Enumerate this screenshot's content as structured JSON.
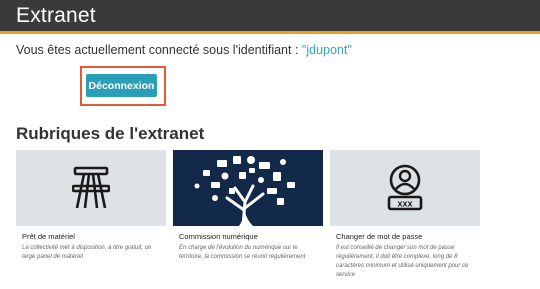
{
  "header": {
    "title": "Extranet"
  },
  "welcome": {
    "prefix": "Vous êtes actuellement connecté sous l'identifiant : ",
    "username": "\"jdupont\""
  },
  "logout": {
    "label": "Déconnexion"
  },
  "section": {
    "title": "Rubriques de l'extranet"
  },
  "cards": [
    {
      "title": "Prêt de matériel",
      "text": "La collectivité met à disposition, à titre gratuit, un large panel de matériel",
      "icon": "picnic-table-icon"
    },
    {
      "title": "Commission numérique",
      "text": "En charge de l'évolution du numérique sur le territoire, la commission se réunit régulièrement",
      "icon": "digital-tree-illustration"
    },
    {
      "title": "Changer de mot de passe",
      "text": "Il est conseillé de changer son mot de passe régulièrement, il doit être complexe, long de 8 caractères minimum et utilisé uniquement pour ce service",
      "icon": "user-password-icon"
    }
  ],
  "colors": {
    "header_bg": "#3a3a3a",
    "header_accent": "#f0a11c",
    "button_bg": "#2a9fb8",
    "highlight_border": "#e25b33",
    "link": "#2ea7bf"
  }
}
